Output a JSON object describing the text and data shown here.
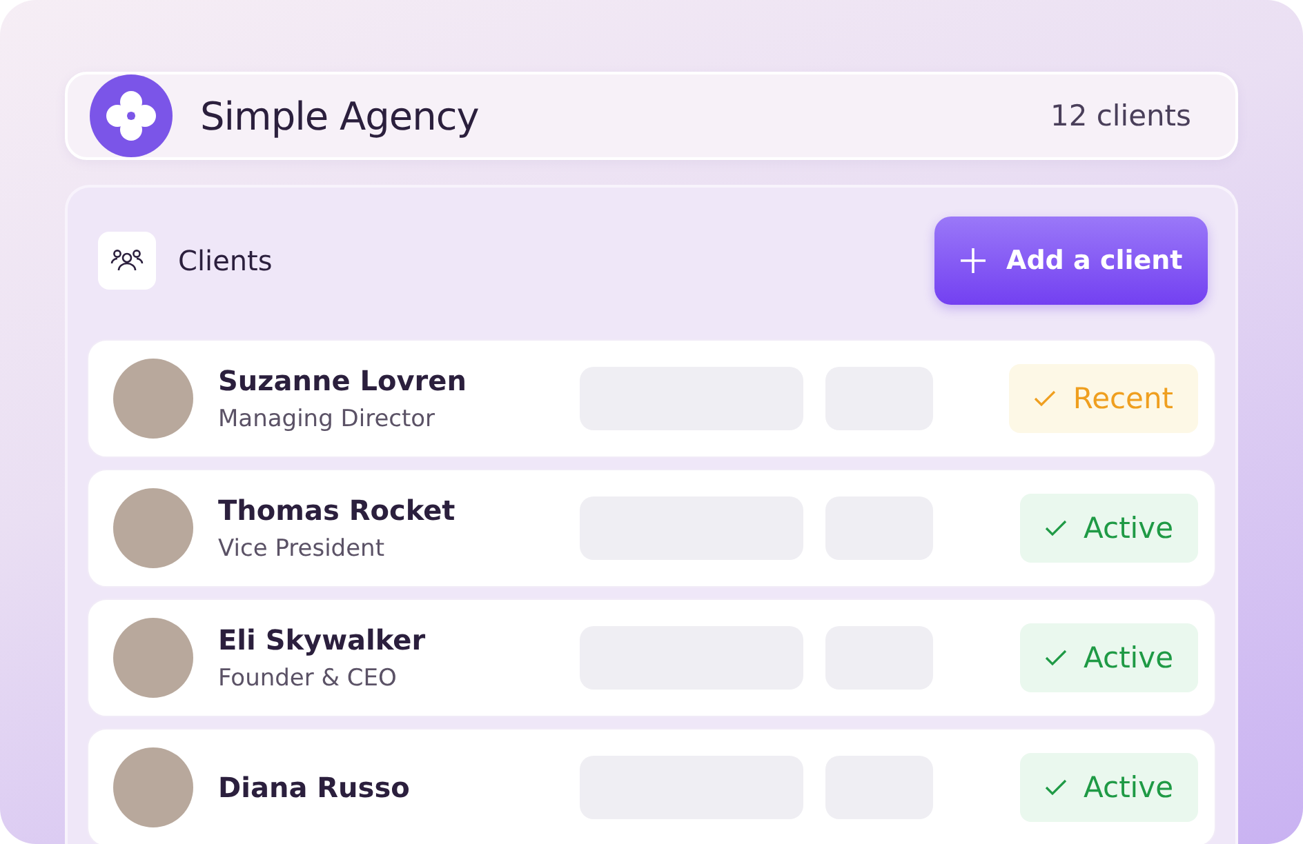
{
  "header": {
    "title": "Simple Agency",
    "count": "12 clients"
  },
  "panel": {
    "title": "Clients",
    "add_button": {
      "label": "Add a client"
    }
  },
  "clients": [
    {
      "name": "Suzanne Lovren",
      "role": "Managing Director",
      "status": {
        "kind": "recent",
        "label": "Recent"
      }
    },
    {
      "name": "Thomas Rocket",
      "role": "Vice President",
      "status": {
        "kind": "active",
        "label": "Active"
      }
    },
    {
      "name": "Eli Skywalker",
      "role": "Founder & CEO",
      "status": {
        "kind": "active",
        "label": "Active"
      }
    },
    {
      "name": "Diana Russo",
      "status": {
        "kind": "active",
        "label": "Active"
      }
    }
  ]
}
